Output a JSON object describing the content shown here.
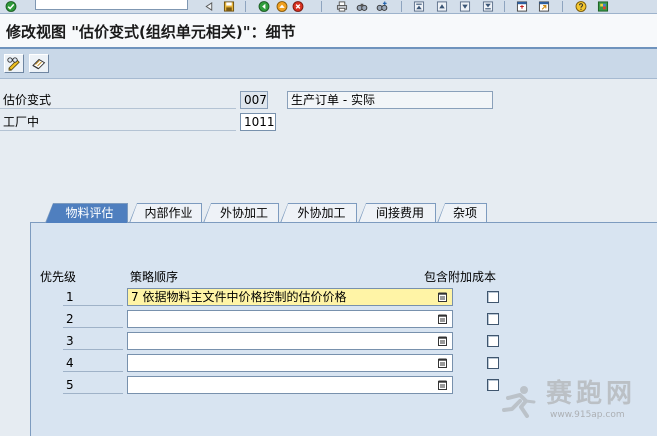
{
  "window": {
    "title": "修改视图 \"估价变式(组织单元相关)\"：细节"
  },
  "system_toolbar": {
    "command_field": {
      "value": ""
    },
    "icons": [
      "enter-icon",
      "collapse-icon",
      "save-icon",
      "back-icon",
      "exit-icon",
      "cancel-icon",
      "print-icon",
      "find-icon",
      "find-next-icon",
      "first-page-icon",
      "previous-page-icon",
      "next-page-icon",
      "last-page-icon",
      "create-session-icon",
      "create-shortcut-icon",
      "help-icon",
      "layout-menu-icon"
    ]
  },
  "app_toolbar": {
    "icons": [
      "display-change-icon",
      "other-entry-icon"
    ]
  },
  "header_fields": {
    "valuation_variant": {
      "label": "估价变式",
      "code": "007",
      "description": "生产订单 - 实际"
    },
    "plant": {
      "label": "工厂中",
      "value": "1011"
    }
  },
  "tabs": [
    {
      "label": "物料评估",
      "active": true
    },
    {
      "label": "内部作业",
      "active": false
    },
    {
      "label": "外协加工",
      "active": false
    },
    {
      "label": "外协加工",
      "active": false
    },
    {
      "label": "间接费用",
      "active": false
    },
    {
      "label": "杂项",
      "active": false
    }
  ],
  "strategy_table": {
    "columns": {
      "priority": "优先级",
      "strategy": "策略顺序",
      "additive_costs": "包含附加成本"
    },
    "rows": [
      {
        "priority": "1",
        "strategy": "7 依据物料主文件中价格控制的估价价格",
        "include_additive_costs": false,
        "highlighted": true
      },
      {
        "priority": "2",
        "strategy": "",
        "include_additive_costs": false,
        "highlighted": false
      },
      {
        "priority": "3",
        "strategy": "",
        "include_additive_costs": false,
        "highlighted": false
      },
      {
        "priority": "4",
        "strategy": "",
        "include_additive_costs": false,
        "highlighted": false
      },
      {
        "priority": "5",
        "strategy": "",
        "include_additive_costs": false,
        "highlighted": false
      }
    ]
  },
  "watermark": {
    "brand": "赛跑网",
    "url": "www.915ap.com"
  },
  "colors": {
    "active_tab": "#4f7fbf",
    "focus_field": "#fff4a6",
    "panel": "#d8e4f1",
    "background": "#e6ecf2"
  }
}
